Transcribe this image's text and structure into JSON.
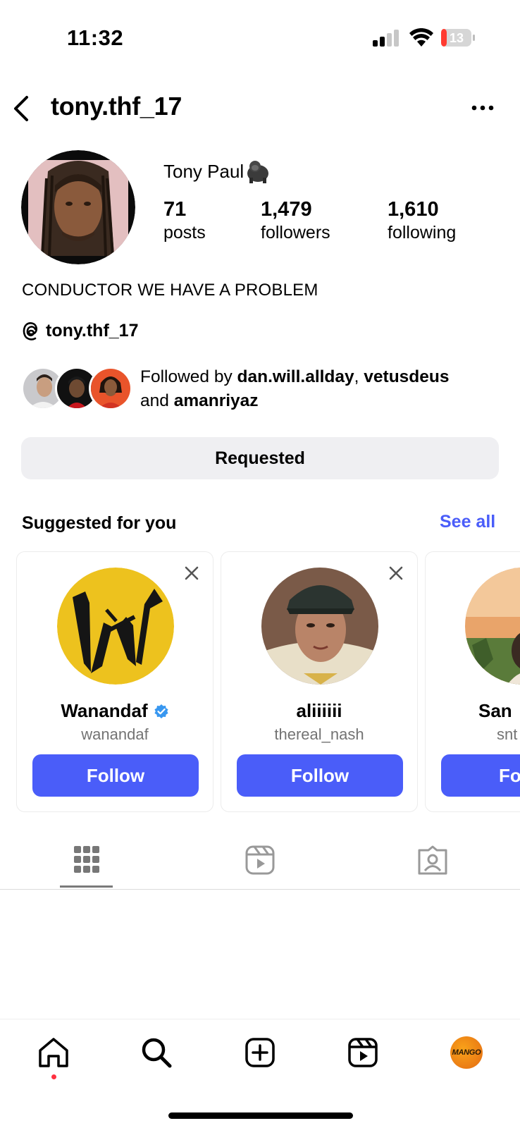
{
  "status_bar": {
    "time": "11:32",
    "battery": "13"
  },
  "header": {
    "username": "tony.thf_17"
  },
  "profile": {
    "display_name": "Tony Paul",
    "stats": [
      {
        "value": "71",
        "label": "posts"
      },
      {
        "value": "1,479",
        "label": "followers"
      },
      {
        "value": "1,610",
        "label": "following"
      }
    ],
    "bio": "CONDUCTOR WE HAVE A PROBLEM",
    "threads_handle": "tony.thf_17",
    "followed_by": {
      "prefix": "Followed by",
      "user1": "dan.will.allday",
      "sep": ",",
      "user2": "vetusdeus",
      "and": "and",
      "user3": "amanriyaz"
    },
    "action_button": "Requested"
  },
  "suggested": {
    "title": "Suggested for you",
    "see_all": "See all",
    "cards": [
      {
        "name": "Wanandaf",
        "handle": "wanandaf",
        "verified": true,
        "button": "Follow"
      },
      {
        "name": "aliiiiii",
        "handle": "thereal_nash",
        "verified": false,
        "button": "Follow"
      },
      {
        "name": "San",
        "handle": "snt",
        "verified": false,
        "button": "Fol"
      }
    ]
  },
  "profile_tabs": [
    "grid-icon",
    "reels-icon",
    "tagged-icon"
  ],
  "bottom_nav": {
    "items": [
      "home-icon",
      "search-icon",
      "create-icon",
      "reels-icon",
      "profile-avatar"
    ],
    "profile_thumb_text": "MANGO"
  },
  "colors": {
    "accent": "#4a5df9",
    "button_grey": "#efeff2",
    "battery_low": "#ff3b30"
  }
}
